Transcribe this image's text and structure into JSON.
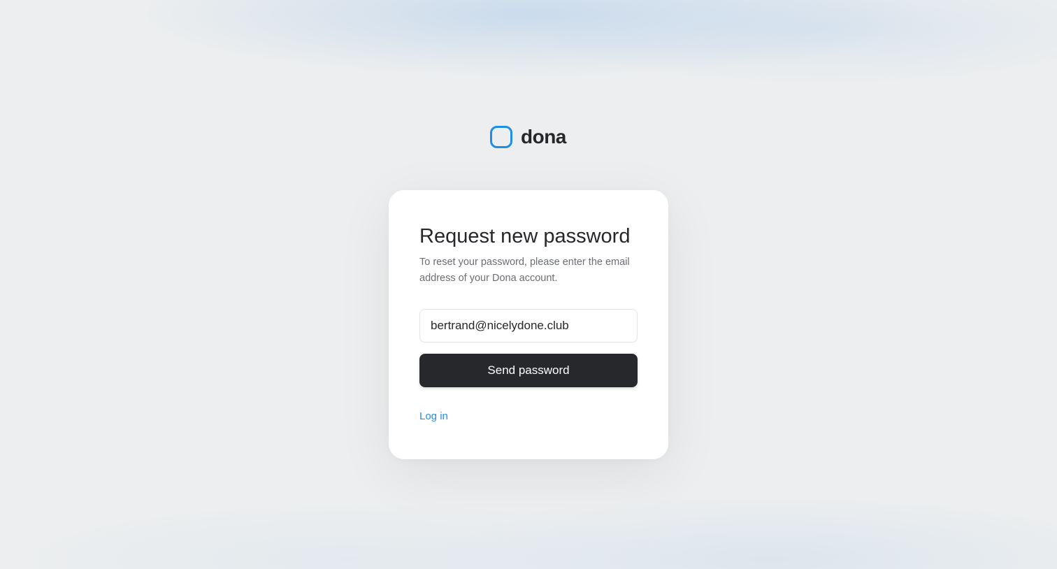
{
  "brand": {
    "name": "dona",
    "logo_icon": "rounded-square-outline-icon",
    "accent_color": "#1e8ee8"
  },
  "form": {
    "title": "Request new password",
    "description": "To reset your password, please enter the email address of your Dona account.",
    "email_value": "bertrand@nicelydone.club",
    "submit_label": "Send password",
    "submit_color": "#27282c",
    "login_link": "Log in"
  }
}
